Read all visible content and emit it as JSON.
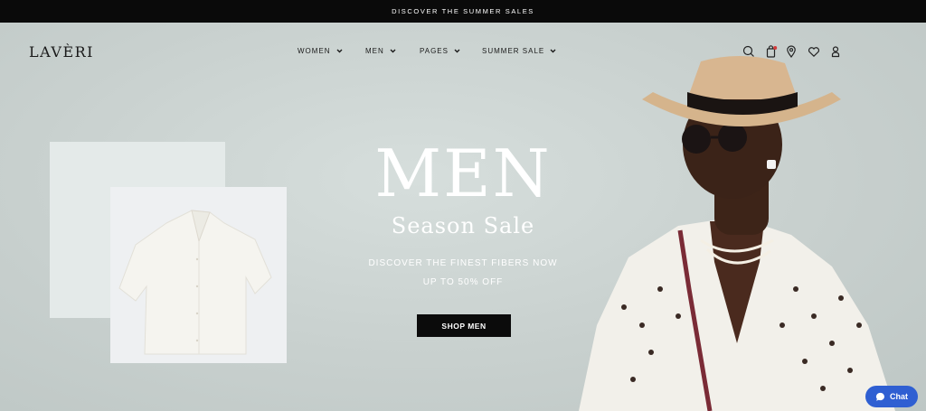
{
  "announcement": "DISCOVER THE SUMMER SALES",
  "logo": "LAVÈRI",
  "nav": [
    {
      "label": "WOMEN"
    },
    {
      "label": "MEN"
    },
    {
      "label": "PAGES"
    },
    {
      "label": "SUMMER SALE"
    }
  ],
  "header_icons": [
    "search-icon",
    "cart-icon",
    "location-icon",
    "wishlist-icon",
    "account-icon"
  ],
  "hero": {
    "title": "MEN",
    "subtitle": "Season Sale",
    "line1": "DISCOVER THE FINEST FIBERS NOW",
    "line2": "UP TO 50% OFF",
    "cta": "SHOP MEN"
  },
  "chat": {
    "label": "Chat"
  },
  "colors": {
    "accent": "#2f5fd2",
    "dark": "#0b0b0b",
    "background": "#c9d1cf"
  }
}
